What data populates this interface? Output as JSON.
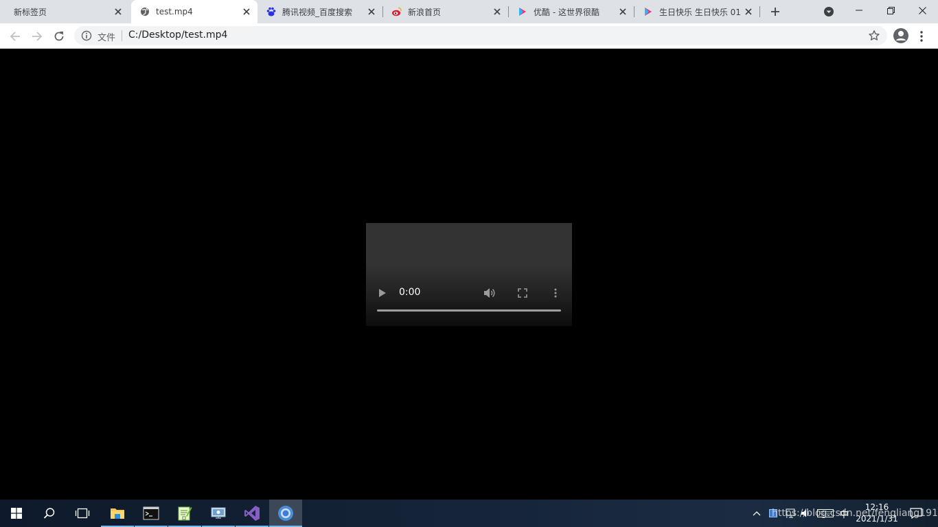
{
  "browser": {
    "tabs": [
      {
        "title": "新标签页",
        "favicon": "none",
        "active": false
      },
      {
        "title": "test.mp4",
        "favicon": "globe-icon",
        "active": true
      },
      {
        "title": "腾讯视频_百度搜索",
        "favicon": "baidu-paw-icon",
        "active": false
      },
      {
        "title": "新浪首页",
        "favicon": "weibo-icon",
        "active": false
      },
      {
        "title": "优酷 - 这世界很酷",
        "favicon": "youku-icon",
        "active": false
      },
      {
        "title": "生日快乐 生日快乐 01",
        "favicon": "youku-icon",
        "active": false
      }
    ],
    "address_bar": {
      "scheme_label": "文件",
      "url": "C:/Desktop/test.mp4"
    }
  },
  "video_player": {
    "current_time": "0:00",
    "progress": 0
  },
  "taskbar": {
    "apps": [
      "start-icon",
      "search-icon",
      "task-view-icon",
      "file-explorer-icon",
      "terminal-icon",
      "notepad-plus-icon",
      "remote-desktop-icon",
      "visual-studio-icon",
      "chrome-icon"
    ],
    "active_app": "chrome-icon",
    "tray": {
      "ime_label": "中",
      "time": "12:16",
      "date": "2021/1/31"
    }
  },
  "watermark": "https://blog.csdn.net/fengliang191",
  "colors": {
    "tabstrip_bg": "#dee1e6",
    "toolbar_bg": "#ffffff",
    "omnibox_bg": "#f1f3f4",
    "video_bg": "#333333",
    "taskbar_bg": "#16253a",
    "taskbar_accent": "#76b9ed"
  }
}
